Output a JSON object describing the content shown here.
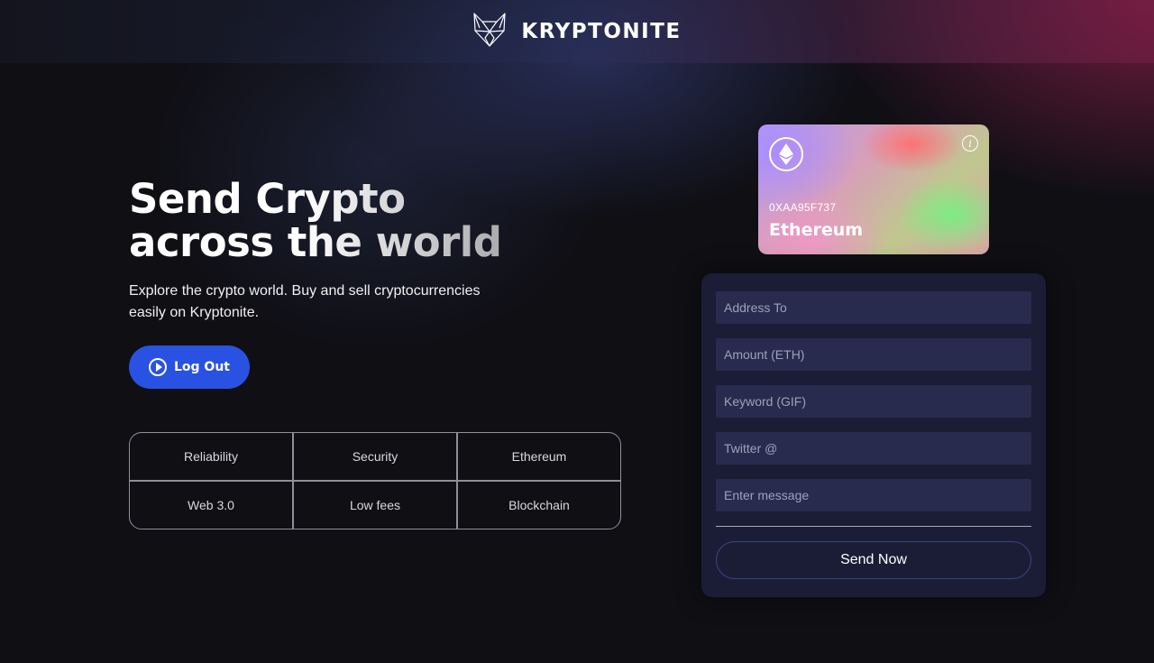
{
  "brand": {
    "name": "KRYPTONITE",
    "logo_icon": "fox-logo-icon"
  },
  "hero": {
    "title_line1": "Send Crypto",
    "title_line2": "across the world",
    "subtitle": "Explore the crypto world. Buy and sell cryptocurrencies easily on Kryptonite.",
    "logout_label": "Log Out"
  },
  "features": [
    "Reliability",
    "Security",
    "Ethereum",
    "Web 3.0",
    "Low fees",
    "Blockchain"
  ],
  "card": {
    "address": "0XAA95F737",
    "network": "Ethereum",
    "icon": "ethereum-icon"
  },
  "form": {
    "address_placeholder": "Address To",
    "amount_placeholder": "Amount (ETH)",
    "keyword_placeholder": "Keyword (GIF)",
    "twitter_placeholder": "Twitter @",
    "message_placeholder": "Enter message",
    "send_label": "Send Now"
  },
  "colors": {
    "accent": "#2952e3",
    "background": "#0f0f14",
    "panel": "#1b1d36",
    "field": "#282b4d"
  }
}
